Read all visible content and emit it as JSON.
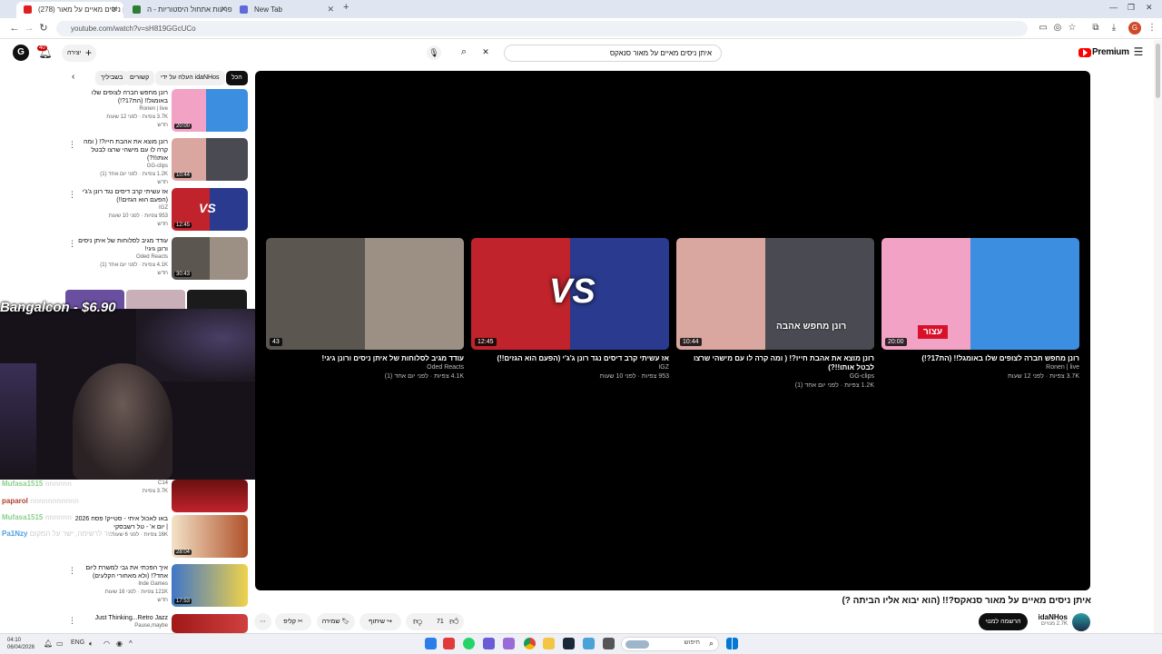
{
  "browser": {
    "tabs": [
      {
        "label": "איתן ניסים מאיים על מאור (278)",
        "color": "#e02020"
      },
      {
        "label": "הפרעות אתחול היסטוריות - ה...",
        "color": "#2e7d32"
      },
      {
        "label": "New Tab",
        "color": "#5f6ad8"
      }
    ],
    "url": "youtube.com/watch?v=sH819GGcUCo"
  },
  "yt": {
    "premium_label": "Premium",
    "search_query": "איתן ניסים מאיים על מאור סנאקס",
    "create_label": "יצירה",
    "notif_count": "40",
    "avatar_letter": "G"
  },
  "chips": [
    "הכל",
    "העלה על ידי idaNHos",
    "קשורים",
    "בשביליך"
  ],
  "related": [
    {
      "title": "רונן מחפש חברה לצופים שלו באומגל!! (הת17?!)",
      "channel": "Ronen | live",
      "meta": "3.7K צפיות · לפני 12 שעות",
      "badge": "חדש",
      "duration": "20:00"
    },
    {
      "title": "רונן מוצא את אהבת חייו?! ( ומה קרה לו עם מישהי שרצו לבטל אותו!!?)",
      "channel": "GG-clips",
      "meta": "1.2K צפיות · לפני יום אחד (1)",
      "badge": "חדש",
      "duration": "10:44"
    },
    {
      "title": "אז עשיתי קרב דיסים נגד רונן ג'ג'י (הפעם הוא הגזים!!)",
      "channel": "IGZ",
      "meta": "953 צפיות · לפני 10 שעות",
      "badge": "חדש",
      "duration": "12:45"
    },
    {
      "title": "עודד מגיב לסלוחות של איתן ניסים ורונן גיגי!",
      "channel": "Oded Reacts",
      "meta": "4.1K צפיות · לפני יום אחד (1)",
      "badge": "חדש",
      "duration": "30:43"
    }
  ],
  "related_lower": [
    {
      "title": "באו לאכול איתי - סטייק! פסח 2026 | יום א' - טל רשבסקי",
      "channel": "",
      "meta": "16K צפיות · לפני 6 שעות",
      "duration": "28:04"
    },
    {
      "title": "איך הפכתי את גבי למשרת ליום אחד?! (ולא מאחורי הקלעים)",
      "channel": "Inde Games",
      "meta": "121K צפיות · לפני 16 שעות",
      "badge": "חדש",
      "duration": "17:53"
    },
    {
      "title": "Just Thinking...Retro Jazz",
      "channel": "Pause,maybe",
      "meta": "",
      "duration": ""
    }
  ],
  "partial_item": {
    "meta1": "C14",
    "meta2": "3.7K צפיות"
  },
  "endcards": [
    {
      "title": "רונן מחפש חברה לצופים שלו באומגל!! (הת17?!)",
      "channel": "Ronen | live",
      "meta": "3.7K צפיות · לפני 12 שעות",
      "duration": "20:00",
      "colors": [
        "#f2a2c4",
        "#3b8ee0"
      ]
    },
    {
      "title": "רונן מוצא את אהבת חייו?! ( ומה קרה לו עם מישהי שרצו לבטל אותו!!?)",
      "channel": "GG-clips",
      "meta": "1.2K צפיות · לפני יום אחד (1)",
      "duration": "10:44",
      "colors": [
        "#d9a6a0",
        "#4a4a52"
      ]
    },
    {
      "title": "אז עשיתי קרב דיסים נגד רונן ג'ג'י (הפעם הוא הגזים!!)",
      "channel": "IGZ",
      "meta": "953 צפיות · לפני 10 שעות",
      "duration": "12:45",
      "colors": [
        "#c0232b",
        "#2a3b8f"
      ]
    },
    {
      "title": "עודד מגיב לסלוחות של איתן ניסים ורונן גיגי!",
      "channel": "Oded Reacts",
      "meta": "4.1K צפיות · לפני יום אחד (1)",
      "duration": "43",
      "colors": [
        "#5b5650",
        "#9c8f84"
      ]
    }
  ],
  "endcard_labels": {
    "vs": "VS",
    "flag_text": "עצור",
    "love_text": "רונן מחפש אהבה"
  },
  "stream": {
    "donation": "Bangalcon - $6.90",
    "chat": [
      {
        "user": "paparol",
        "msg": "nnnnnnnnnnn",
        "color": "#b04030"
      },
      {
        "user": "Mufasa1515",
        "msg": "nnnnnn",
        "color": "#8ad08a"
      },
      {
        "user": "Pa1Nzy",
        "msg": "ישר לרשימה, ישר על המקום",
        "color": "#4aa0e0"
      }
    ]
  },
  "video": {
    "title": "איתן ניסים מאיים על מאור סנאקס?!! (הוא יבוא אליו הביתה ?)",
    "channel": "idaNHos",
    "subs": "2.7K מנויים",
    "subscribe": "הרשמה למנוי",
    "likes": "71",
    "share": "שיתוף",
    "save": "שמירה",
    "clip": "קליפ"
  },
  "taskbar": {
    "time": "04:10",
    "date": "06/04/2026",
    "lang": "ENG",
    "search_placeholder": "חיפוש"
  }
}
